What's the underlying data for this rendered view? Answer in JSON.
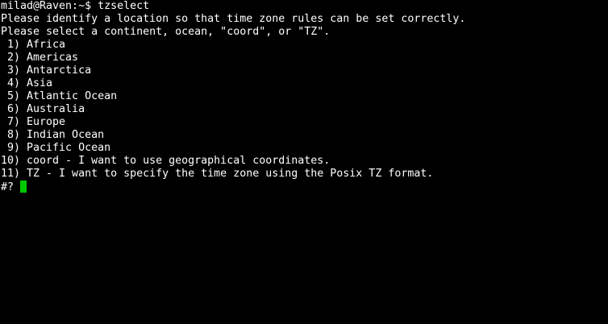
{
  "terminal": {
    "prompt": "milad@Raven:~$ ",
    "command": "tzselect",
    "intro_line_1": "Please identify a location so that time zone rules can be set correctly.",
    "intro_line_2": "Please select a continent, ocean, \"coord\", or \"TZ\".",
    "options": [
      " 1) Africa",
      " 2) Americas",
      " 3) Antarctica",
      " 4) Asia",
      " 5) Atlantic Ocean",
      " 6) Australia",
      " 7) Europe",
      " 8) Indian Ocean",
      " 9) Pacific Ocean",
      "10) coord - I want to use geographical coordinates.",
      "11) TZ - I want to specify the time zone using the Posix TZ format."
    ],
    "input_prompt": "#? ",
    "cursor_color": "#00c800"
  }
}
